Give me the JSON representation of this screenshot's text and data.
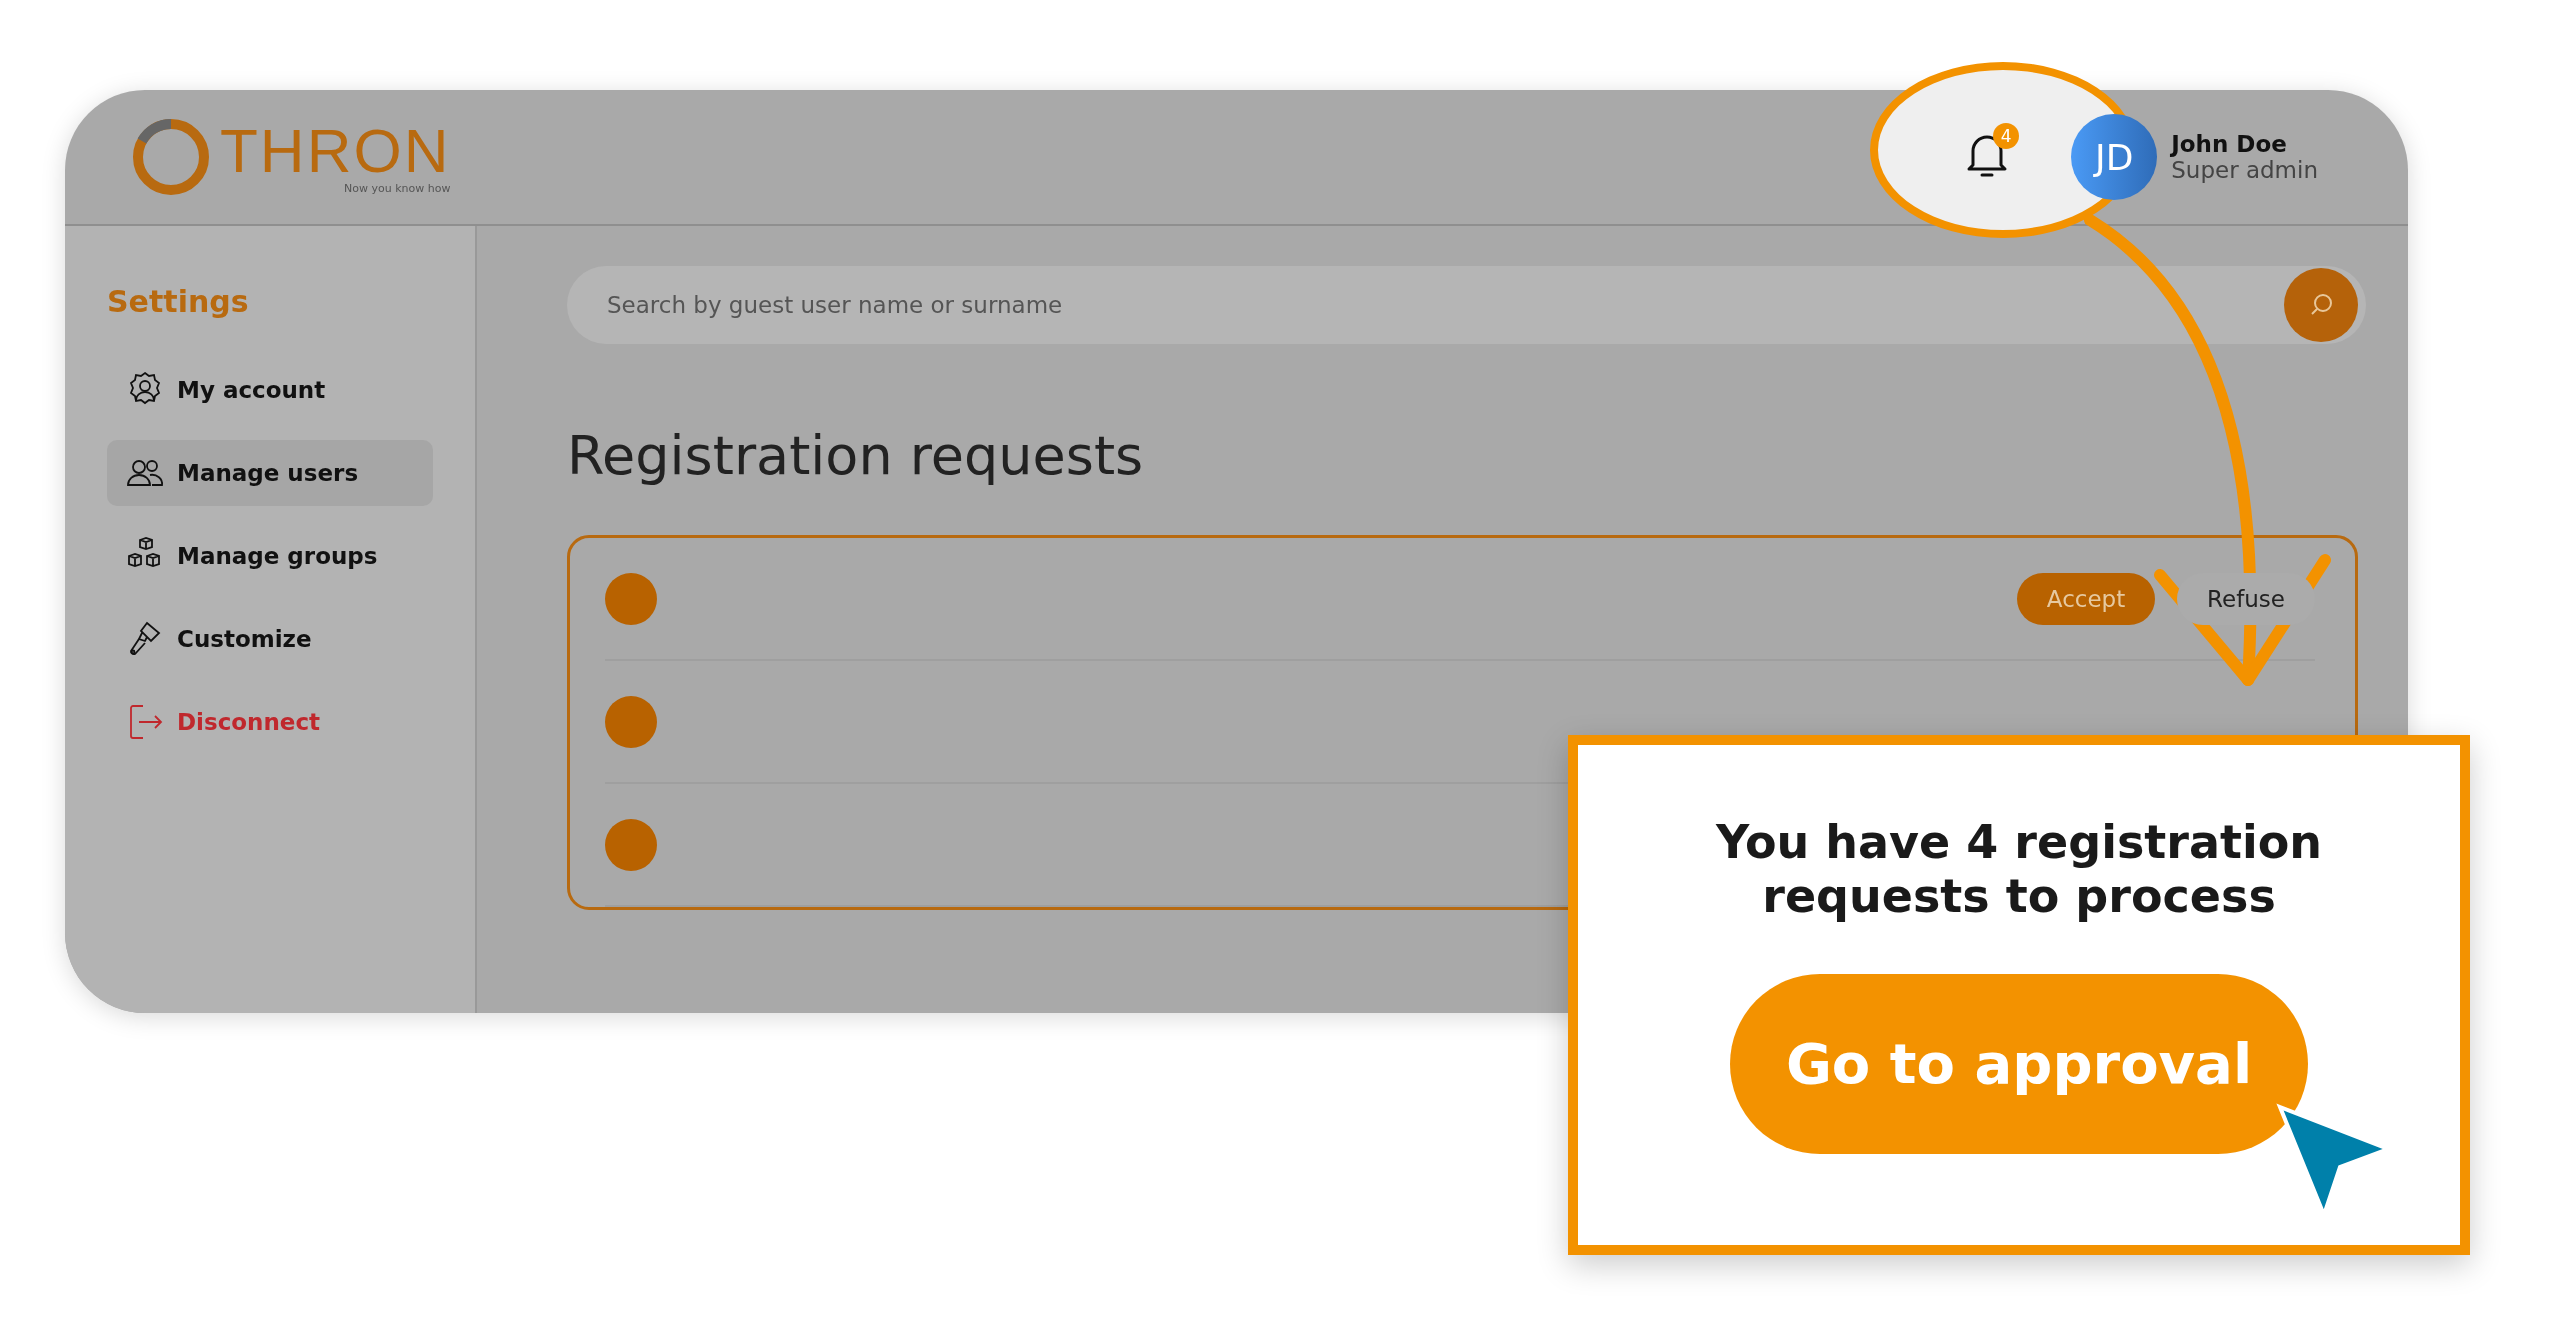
{
  "header": {
    "logo": {
      "name": "THRON",
      "tagline": "Now you know how"
    },
    "notifications": {
      "count": "4"
    },
    "user": {
      "initials": "JD",
      "name": "John Doe",
      "role": "Super admin"
    }
  },
  "sidebar": {
    "title": "Settings",
    "items": [
      {
        "label": "My account",
        "kind": "account",
        "selected": false
      },
      {
        "label": "Manage users",
        "kind": "users",
        "selected": true
      },
      {
        "label": "Manage groups",
        "kind": "groups",
        "selected": false
      },
      {
        "label": "Customize",
        "kind": "brush",
        "selected": false
      },
      {
        "label": "Disconnect",
        "kind": "logout",
        "selected": false
      }
    ]
  },
  "search": {
    "placeholder": "Search by guest user name or surname"
  },
  "main": {
    "title": "Registration requests",
    "requests": [
      {
        "accept": "Accept",
        "refuse": "Refuse"
      },
      {
        "kind": "covered"
      },
      {
        "kind": "covered"
      }
    ]
  },
  "popup": {
    "message": "You have 4 registration requests to process",
    "button": "Go to approval"
  }
}
